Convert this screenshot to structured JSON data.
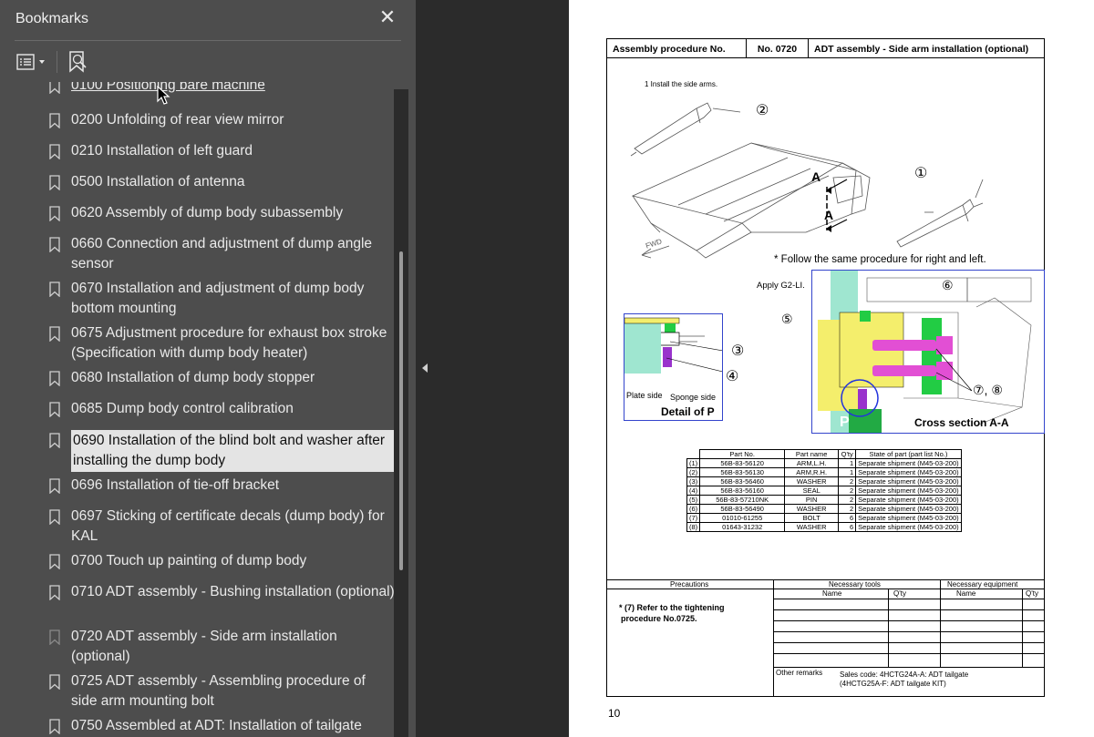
{
  "sidebar": {
    "title": "Bookmarks",
    "close_glyph": "✕",
    "toolbar": {
      "options_icon": "list-options-icon",
      "add_bookmark_icon": "add-bookmark-icon"
    },
    "items": [
      {
        "label": "0100 Positioning bare machine"
      },
      {
        "label": "0200 Unfolding of rear view mirror"
      },
      {
        "label": "0210 Installation of left guard"
      },
      {
        "label": "0500 Installation of antenna"
      },
      {
        "label": "0620 Assembly of dump body subassembly"
      },
      {
        "label": "0660 Connection and adjustment of dump angle sensor"
      },
      {
        "label": "0670 Installation and adjustment of dump body bottom mounting"
      },
      {
        "label": "0675 Adjustment procedure for exhaust box stroke (Specification with dump body heater)"
      },
      {
        "label": "0680 Installation of dump body stopper"
      },
      {
        "label": "0685 Dump body control calibration"
      },
      {
        "label": "0690 Installation of the blind bolt and washer after installing the dump body"
      },
      {
        "label": "0696 Installation of tie-off bracket"
      },
      {
        "label": "0697 Sticking of certificate decals (dump body) for KAL"
      },
      {
        "label": "0700 Touch up painting of dump body"
      },
      {
        "label": "0710 ADT assembly - Bushing installation (optional)"
      },
      {
        "label": "0720 ADT assembly - Side arm installation (optional)"
      },
      {
        "label": "0725 ADT assembly - Assembling procedure of side arm mounting bolt"
      },
      {
        "label": "0750 Assembled at ADT: Installation of tailgate"
      }
    ]
  },
  "document": {
    "page_number": "10",
    "header": {
      "label": "Assembly procedure No.",
      "number": "No. 0720",
      "title": "ADT assembly - Side arm installation (optional)"
    },
    "step": "1 Install the side arms.",
    "note": "* Follow the same procedure for right and left.",
    "apply_label": "Apply G2-LI.",
    "plate_side": "Plate side",
    "sponge_side": "Sponge side",
    "detail_label": "Detail of P",
    "section_label": "Cross section A-A",
    "fwd": "FWD",
    "p_label": "P",
    "a_label": "A",
    "callouts": {
      "c1": "①",
      "c2": "②",
      "c3": "③",
      "c4": "④",
      "c5": "⑤",
      "c6": "⑥",
      "c78": "⑦, ⑧",
      "c6b": "⑥",
      "c5b": "⑤"
    },
    "parts_table": {
      "headers": [
        "Part No.",
        "Part name",
        "Q'ty",
        "State of part (part list No.)"
      ],
      "rows": [
        [
          "(1)",
          "56B-83-56120",
          "ARM,L.H.",
          "1",
          "Separate shipment (M45-03-200)"
        ],
        [
          "(2)",
          "56B-83-56130",
          "ARM,R.H.",
          "1",
          "Separate shipment (M45-03-200)"
        ],
        [
          "(3)",
          "56B-83-56460",
          "WASHER",
          "2",
          "Separate shipment (M45-03-200)"
        ],
        [
          "(4)",
          "56B-83-56160",
          "SEAL",
          "2",
          "Separate shipment (M45-03-200)"
        ],
        [
          "(5)",
          "56B-83-57210NK",
          "PIN",
          "2",
          "Separate shipment (M45-03-200)"
        ],
        [
          "(6)",
          "56B-83-56490",
          "WASHER",
          "2",
          "Separate shipment (M45-03-200)"
        ],
        [
          "(7)",
          "01010-61255",
          "BOLT",
          "6",
          "Separate shipment (M45-03-200)"
        ],
        [
          "(8)",
          "01643-31232",
          "WASHER",
          "6",
          "Separate shipment (M45-03-200)"
        ]
      ]
    },
    "precautions": {
      "col1": "Precautions",
      "col2": "Necessary tools",
      "col3": "Necessary equipment",
      "name": "Name",
      "qty": "Q'ty",
      "text1": "* (7) Refer to the tightening",
      "text2": "procedure No.0725.",
      "other_remarks": "Other remarks",
      "sales1": "Sales code: 4HCTG24A-A: ADT tailgate",
      "sales2": "(4HCTG25A-F: ADT tailgate  KIT)"
    }
  }
}
